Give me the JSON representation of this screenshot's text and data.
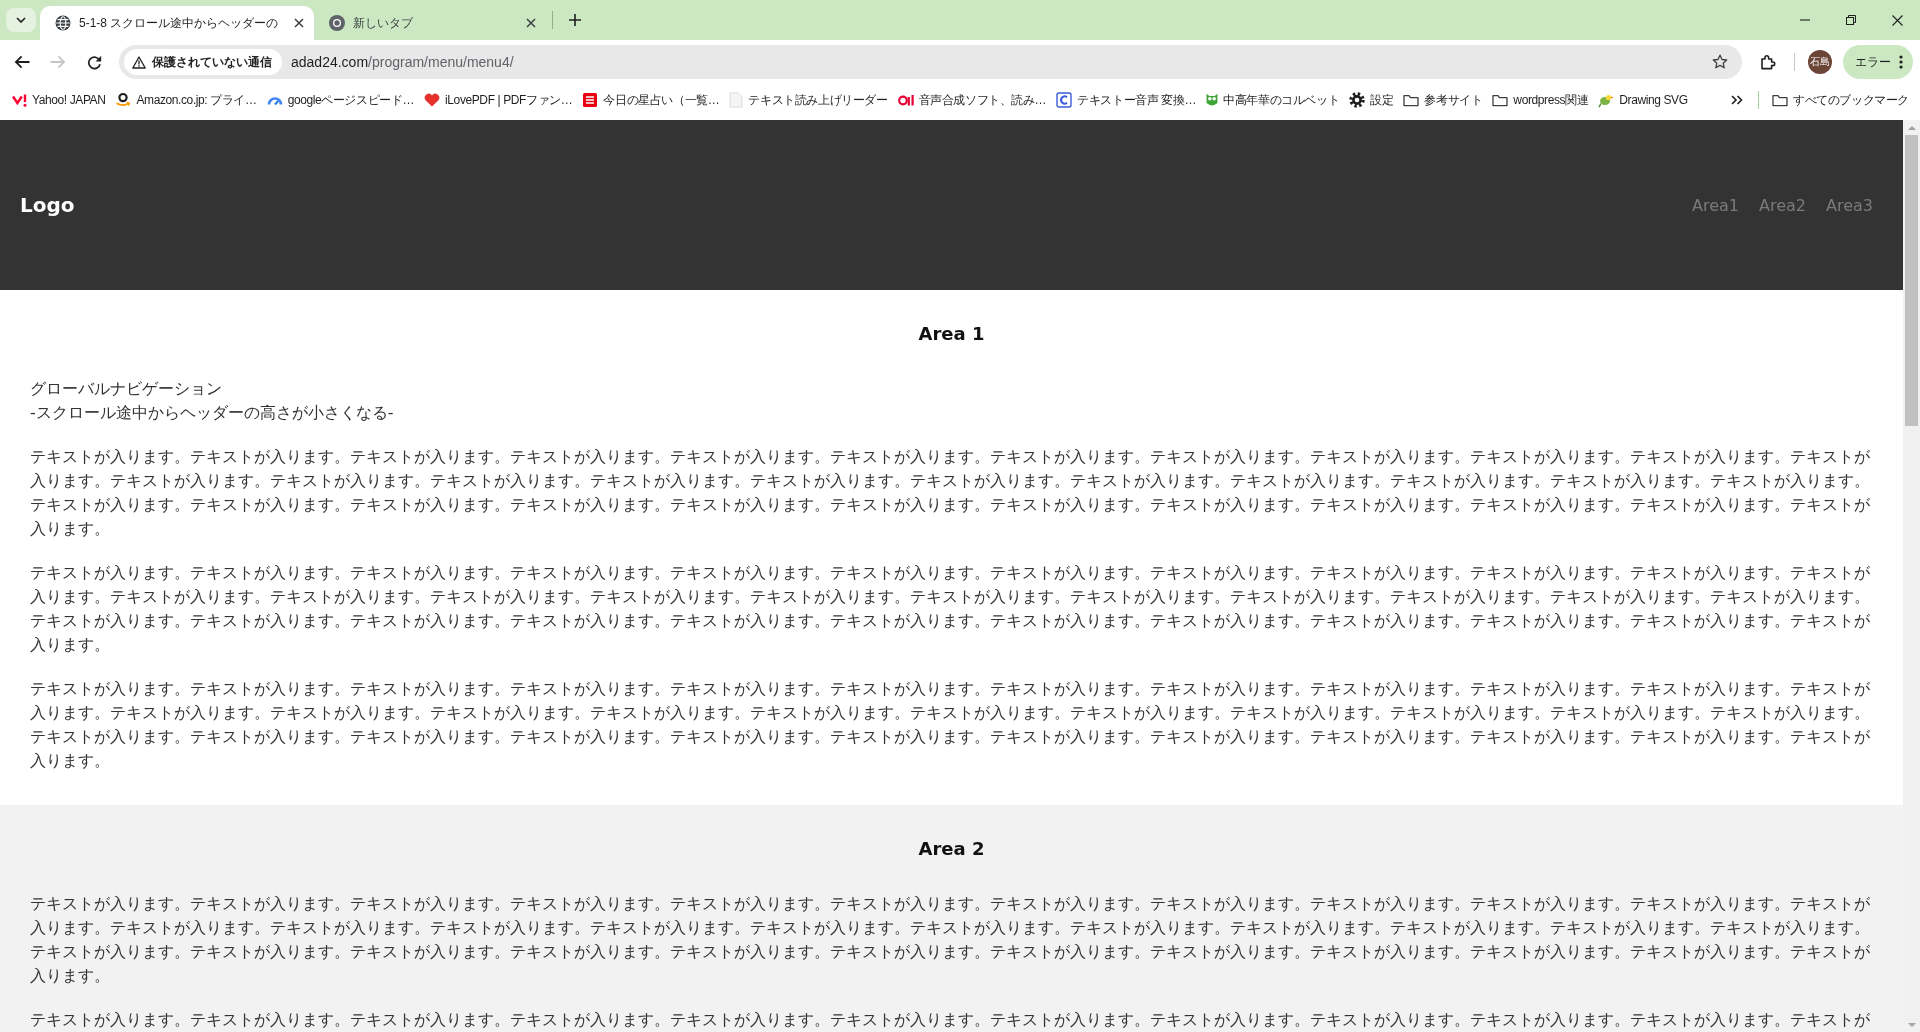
{
  "browser": {
    "tabs": [
      {
        "title": "5-1-8 スクロール途中からヘッダーの",
        "selected": true
      },
      {
        "title": "新しいタブ",
        "selected": false
      }
    ],
    "toolbar": {
      "nav_buttons": [
        {
          "kind": "back",
          "disabled": false
        },
        {
          "kind": "forward",
          "disabled": true
        },
        {
          "kind": "reload",
          "disabled": false
        }
      ],
      "security_label": "保護されていない通信",
      "url": "**adad24.com**/program/menu/menu4/",
      "profile_name": "石島",
      "error_label": "エラー"
    },
    "bookmarks": [
      {
        "label": "Yahoo! JAPAN",
        "kind": "site"
      },
      {
        "label": "Amazon.co.jp: プライ…",
        "kind": "site"
      },
      {
        "label": "googleページスピード…",
        "kind": "site"
      },
      {
        "label": "iLovePDF | PDFファン…",
        "kind": "site"
      },
      {
        "label": "今日の星占い（一覧…",
        "kind": "site"
      },
      {
        "label": "テキスト読み上げリーダー",
        "kind": "site"
      },
      {
        "label": "音声合成ソフト、読み…",
        "kind": "site"
      },
      {
        "label": "テキストー音声 変換…",
        "kind": "site"
      },
      {
        "label": "中高年華のコルベット",
        "kind": "site"
      },
      {
        "label": "設定",
        "kind": "site"
      },
      {
        "label": "参考サイト",
        "kind": "folder"
      },
      {
        "label": "wordpress関連",
        "kind": "folder"
      },
      {
        "label": "Drawing SVG",
        "kind": "site"
      }
    ],
    "all_bookmarks": "すべてのブックマーク"
  },
  "page": {
    "header": {
      "logo": "Logo",
      "nav": [
        "Area1",
        "Area2",
        "Area3"
      ]
    },
    "sections": [
      {
        "title": "Area 1",
        "intro": [
          "グローバルナビゲーション",
          "-スクロール途中からヘッダーの高さが小さくなる-"
        ],
        "paragraphs": [
          "テキストが入ります。テキストが入ります。テキストが入ります。テキストが入ります。テキストが入ります。テキストが入ります。テキストが入ります。テキストが入ります。テキストが入ります。テキストが入ります。テキストが入ります。テキストが入ります。テキストが入ります。テキストが入ります。テキストが入ります。テキストが入ります。テキストが入ります。テキストが入ります。テキストが入ります。テキストが入ります。テキストが入ります。テキストが入ります。テキストが入ります。テキストが入ります。テキストが入ります。テキストが入ります。テキストが入ります。テキストが入ります。テキストが入ります。テキストが入ります。テキストが入ります。テキストが入ります。テキストが入ります。テキストが入ります。テキストが入ります。",
          "テキストが入ります。テキストが入ります。テキストが入ります。テキストが入ります。テキストが入ります。テキストが入ります。テキストが入ります。テキストが入ります。テキストが入ります。テキストが入ります。テキストが入ります。テキストが入ります。テキストが入ります。テキストが入ります。テキストが入ります。テキストが入ります。テキストが入ります。テキストが入ります。テキストが入ります。テキストが入ります。テキストが入ります。テキストが入ります。テキストが入ります。テキストが入ります。テキストが入ります。テキストが入ります。テキストが入ります。テキストが入ります。テキストが入ります。テキストが入ります。テキストが入ります。テキストが入ります。テキストが入ります。テキストが入ります。テキストが入ります。",
          "テキストが入ります。テキストが入ります。テキストが入ります。テキストが入ります。テキストが入ります。テキストが入ります。テキストが入ります。テキストが入ります。テキストが入ります。テキストが入ります。テキストが入ります。テキストが入ります。テキストが入ります。テキストが入ります。テキストが入ります。テキストが入ります。テキストが入ります。テキストが入ります。テキストが入ります。テキストが入ります。テキストが入ります。テキストが入ります。テキストが入ります。テキストが入ります。テキストが入ります。テキストが入ります。テキストが入ります。テキストが入ります。テキストが入ります。テキストが入ります。テキストが入ります。テキストが入ります。テキストが入ります。テキストが入ります。テキストが入ります。"
        ]
      },
      {
        "title": "Area 2",
        "paragraphs": [
          "テキストが入ります。テキストが入ります。テキストが入ります。テキストが入ります。テキストが入ります。テキストが入ります。テキストが入ります。テキストが入ります。テキストが入ります。テキストが入ります。テキストが入ります。テキストが入ります。テキストが入ります。テキストが入ります。テキストが入ります。テキストが入ります。テキストが入ります。テキストが入ります。テキストが入ります。テキストが入ります。テキストが入ります。テキストが入ります。テキストが入ります。テキストが入ります。テキストが入ります。テキストが入ります。テキストが入ります。テキストが入ります。テキストが入ります。テキストが入ります。テキストが入ります。テキストが入ります。テキストが入ります。テキストが入ります。テキストが入ります。",
          "テキストが入ります。テキストが入ります。テキストが入ります。テキストが入ります。テキストが入ります。テキストが入ります。テキストが入ります。テキストが入ります。テキストが入ります。テキストが入ります。テキストが入ります。テキストが"
        ]
      }
    ]
  }
}
